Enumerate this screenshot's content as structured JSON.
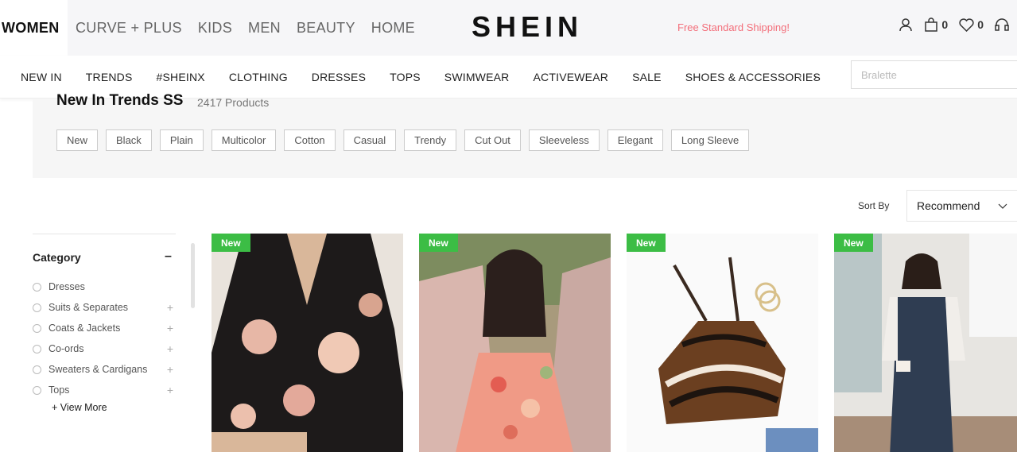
{
  "top_tabs": [
    "WOMEN",
    "CURVE + PLUS",
    "KIDS",
    "MEN",
    "BEAUTY",
    "HOME"
  ],
  "logo": "SHEIN",
  "promo": "Free Standard Shipping!",
  "icons": {
    "cart_count": "0",
    "wishlist_count": "0"
  },
  "categories": [
    "NEW IN",
    "TRENDS",
    "#SHEINX",
    "CLOTHING",
    "DRESSES",
    "TOPS",
    "SWIMWEAR",
    "ACTIVEWEAR",
    "SALE",
    "SHOES & ACCESSORIES"
  ],
  "search": {
    "placeholder": "Bralette"
  },
  "header": {
    "title": "New In Trends SS",
    "count": "2417 Products"
  },
  "tags": [
    "New",
    "Black",
    "Plain",
    "Multicolor",
    "Cotton",
    "Casual",
    "Trendy",
    "Cut Out",
    "Sleeveless",
    "Elegant",
    "Long Sleeve"
  ],
  "sort": {
    "label": "Sort By",
    "value": "Recommend"
  },
  "sidebar": {
    "title": "Category",
    "items": [
      {
        "label": "Dresses"
      },
      {
        "label": "Suits & Separates"
      },
      {
        "label": "Coats & Jackets"
      },
      {
        "label": "Co-ords"
      },
      {
        "label": "Sweaters & Cardigans"
      },
      {
        "label": "Tops"
      }
    ],
    "view_more": "+ View More"
  },
  "products": [
    {
      "badge": "New"
    },
    {
      "badge": "New"
    },
    {
      "badge": "New"
    },
    {
      "badge": "New"
    }
  ],
  "colors": {
    "badge": "#3cbd45",
    "promo": "#f36e7a"
  }
}
